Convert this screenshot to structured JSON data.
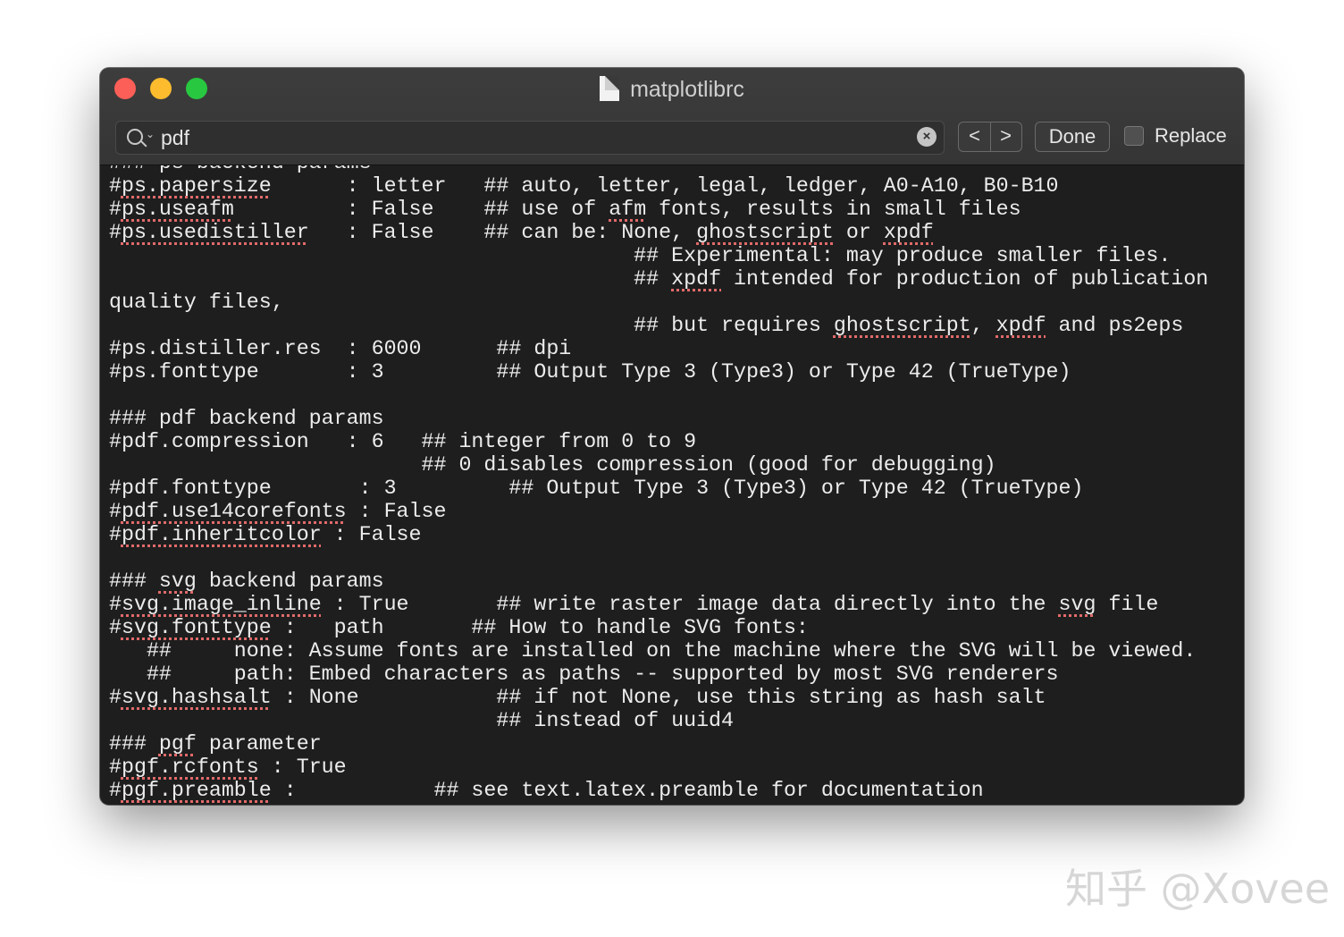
{
  "window": {
    "title": "matplotlibrc"
  },
  "find_bar": {
    "search_value": "pdf",
    "prev_label": "<",
    "next_label": ">",
    "done_label": "Done",
    "replace_label": "Replace",
    "replace_checked": false
  },
  "editor": {
    "lines": [
      [
        {
          "t": "### ps backend params"
        }
      ],
      [
        {
          "t": "#"
        },
        {
          "t": "ps.papersize",
          "sq": true
        },
        {
          "t": "      : letter   ## auto, letter, legal, ledger, A0-A10, B0-B10"
        }
      ],
      [
        {
          "t": "#"
        },
        {
          "t": "ps.useafm",
          "sq": true
        },
        {
          "t": "         : False    ## use of "
        },
        {
          "t": "afm",
          "sq": true
        },
        {
          "t": " fonts, results in small files"
        }
      ],
      [
        {
          "t": "#"
        },
        {
          "t": "ps.usedistiller",
          "sq": true
        },
        {
          "t": "   : False    ## can be: None, "
        },
        {
          "t": "ghostscript",
          "sq": true
        },
        {
          "t": " or "
        },
        {
          "t": "xpdf",
          "sq": true
        }
      ],
      [
        {
          "t": "                                          ## Experimental: may produce smaller files."
        }
      ],
      [
        {
          "t": "                                          ## "
        },
        {
          "t": "xpdf",
          "sq": true
        },
        {
          "t": " intended for production of publication"
        }
      ],
      [
        {
          "t": "quality files,"
        }
      ],
      [
        {
          "t": "                                          ## but requires "
        },
        {
          "t": "ghostscript",
          "sq": true
        },
        {
          "t": ", "
        },
        {
          "t": "xpdf",
          "sq": true
        },
        {
          "t": " and ps2eps"
        }
      ],
      [
        {
          "t": "#ps.distiller.res  : 6000      ## dpi"
        }
      ],
      [
        {
          "t": "#ps.fonttype       : 3         ## Output Type 3 (Type3) or Type 42 (TrueType)"
        }
      ],
      [
        {
          "t": ""
        }
      ],
      [
        {
          "t": "### pdf backend params"
        }
      ],
      [
        {
          "t": "#pdf.compression   : 6   ## integer from 0 to 9"
        }
      ],
      [
        {
          "t": "                         ## 0 disables compression (good for debugging)"
        }
      ],
      [
        {
          "t": "#pdf.fonttype       : 3         ## Output Type 3 (Type3) or Type 42 (TrueType)"
        }
      ],
      [
        {
          "t": "#"
        },
        {
          "t": "pdf.use14corefonts",
          "sq": true
        },
        {
          "t": " : False"
        }
      ],
      [
        {
          "t": "#"
        },
        {
          "t": "pdf.inheritcolor",
          "sq": true
        },
        {
          "t": " : False"
        }
      ],
      [
        {
          "t": ""
        }
      ],
      [
        {
          "t": "### "
        },
        {
          "t": "svg",
          "sq": true
        },
        {
          "t": " backend params"
        }
      ],
      [
        {
          "t": "#"
        },
        {
          "t": "svg.image_inline",
          "sq": true
        },
        {
          "t": " : True       ## write raster image data directly into the "
        },
        {
          "t": "svg",
          "sq": true
        },
        {
          "t": " file"
        }
      ],
      [
        {
          "t": "#"
        },
        {
          "t": "svg.fonttype",
          "sq": true
        },
        {
          "t": " :   path       ## How to handle SVG fonts:"
        }
      ],
      [
        {
          "t": "   ##     none: Assume fonts are installed on the machine where the SVG will be viewed."
        }
      ],
      [
        {
          "t": "   ##     path: Embed characters as paths -- supported by most SVG renderers"
        }
      ],
      [
        {
          "t": "#"
        },
        {
          "t": "svg.hashsalt",
          "sq": true
        },
        {
          "t": " : None           ## if not None, use this string as hash salt"
        }
      ],
      [
        {
          "t": "                               ## instead of uuid4"
        }
      ],
      [
        {
          "t": "### "
        },
        {
          "t": "pgf",
          "sq": true
        },
        {
          "t": " parameter"
        }
      ],
      [
        {
          "t": "#"
        },
        {
          "t": "pgf.rcfonts",
          "sq": true
        },
        {
          "t": " : True"
        }
      ],
      [
        {
          "t": "#"
        },
        {
          "t": "pgf.preamble",
          "sq": true
        },
        {
          "t": " :           ## see text.latex.preamble for documentation"
        }
      ]
    ]
  },
  "watermark": {
    "text": "知乎 @Xovee"
  },
  "icons": {
    "window_controls": [
      "close-icon",
      "minimize-icon",
      "zoom-icon"
    ],
    "title": "document-icon",
    "search": "search-icon",
    "clear": "clear-icon"
  },
  "colors": {
    "editor_background": "#1e1e1e",
    "editor_text": "#ececec",
    "spellcheck_underline": "#e26a6a",
    "close": "#fc5f57",
    "minimize": "#fdbc2e",
    "zoom": "#28c840"
  }
}
